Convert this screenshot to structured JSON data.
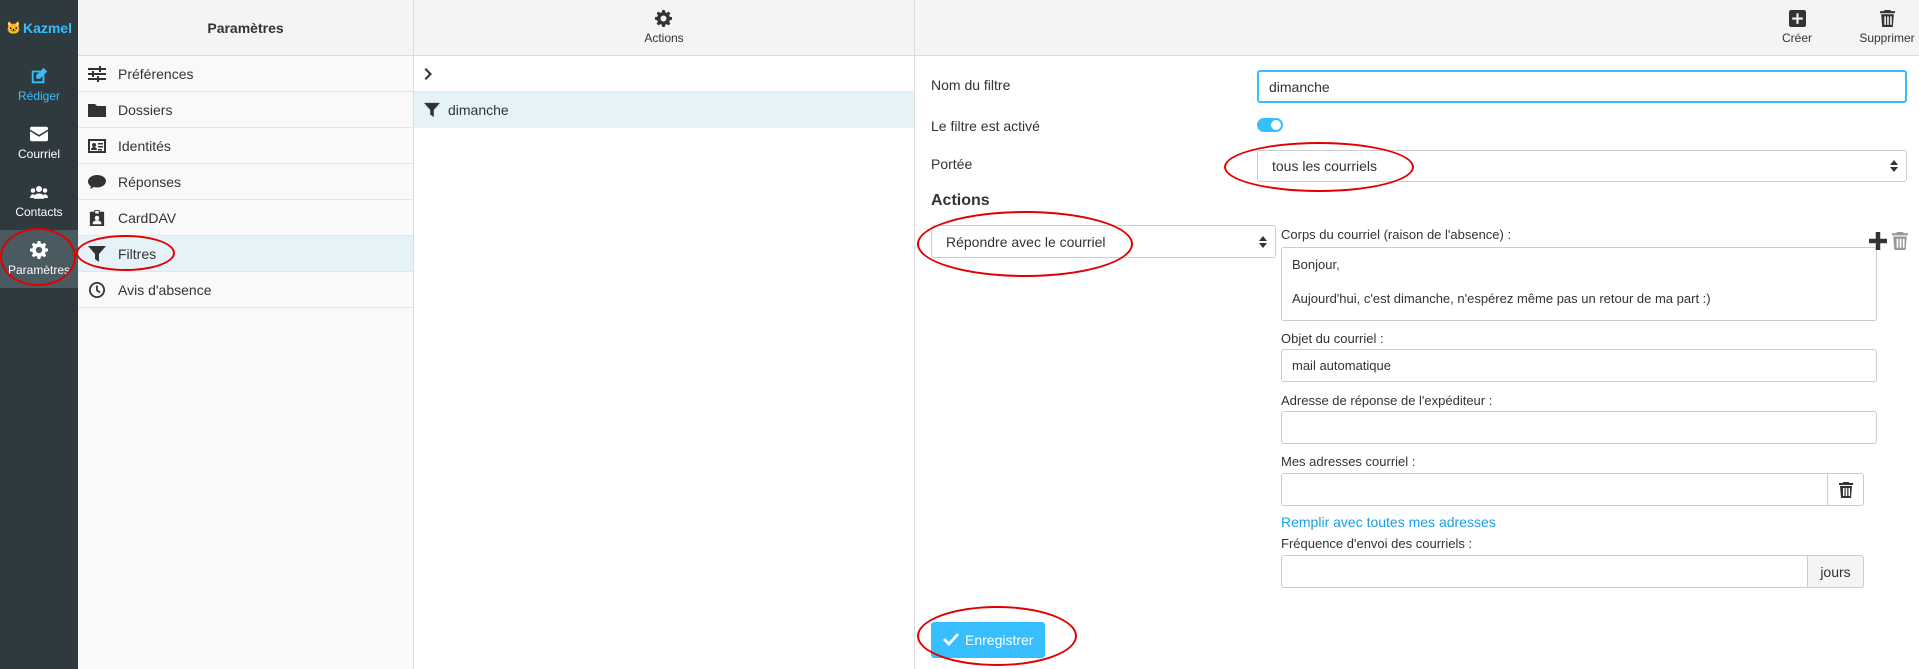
{
  "app": {
    "logo_text": "Kazmel"
  },
  "nav": {
    "items": [
      {
        "label": "Rédiger",
        "icon": "compose-icon"
      },
      {
        "label": "Courriel",
        "icon": "mail-icon"
      },
      {
        "label": "Contacts",
        "icon": "contacts-icon"
      },
      {
        "label": "Paramètres",
        "icon": "gear-icon"
      }
    ]
  },
  "settings": {
    "title": "Paramètres",
    "items": [
      {
        "label": "Préférences",
        "icon": "sliders-icon"
      },
      {
        "label": "Dossiers",
        "icon": "folder-icon"
      },
      {
        "label": "Identités",
        "icon": "id-card-icon"
      },
      {
        "label": "Réponses",
        "icon": "comment-icon"
      },
      {
        "label": "CardDAV",
        "icon": "contact-badge-icon"
      },
      {
        "label": "Filtres",
        "icon": "filter-icon"
      },
      {
        "label": "Avis d'absence",
        "icon": "clock-icon"
      }
    ],
    "selected": "Filtres"
  },
  "filters": {
    "toolbar": {
      "actions_label": "Actions"
    },
    "items": [
      {
        "name": "dimanche"
      }
    ]
  },
  "form": {
    "toolbar": {
      "create_label": "Créer",
      "delete_label": "Supprimer"
    },
    "filter_name_label": "Nom du filtre",
    "filter_name_value": "dimanche",
    "enabled_label": "Le filtre est activé",
    "enabled": true,
    "scope_label": "Portée",
    "scope_value": "tous les courriels",
    "actions_title": "Actions",
    "action_value": "Répondre avec le courriel",
    "body_label": "Corps du courriel (raison de l'absence) :",
    "body_value": "Bonjour,\n\nAujourd'hui, c'est dimanche, n'espérez même pas un retour de ma part :)",
    "subject_label": "Objet du courriel :",
    "subject_value": "mail automatique",
    "reply_address_label": "Adresse de réponse de l'expéditeur :",
    "reply_address_value": "",
    "my_addresses_label": "Mes adresses courriel :",
    "my_addresses_value": "",
    "fill_addresses_link": "Remplir avec toutes mes adresses",
    "frequency_label": "Fréquence d'envoi des courriels :",
    "frequency_value": "",
    "frequency_unit": "jours",
    "save_label": "Enregistrer"
  },
  "colors": {
    "accent": "#37beff",
    "nav_bg": "#2f3a3f",
    "annotation": "#e00000",
    "selected_row": "#e5f2f8"
  }
}
